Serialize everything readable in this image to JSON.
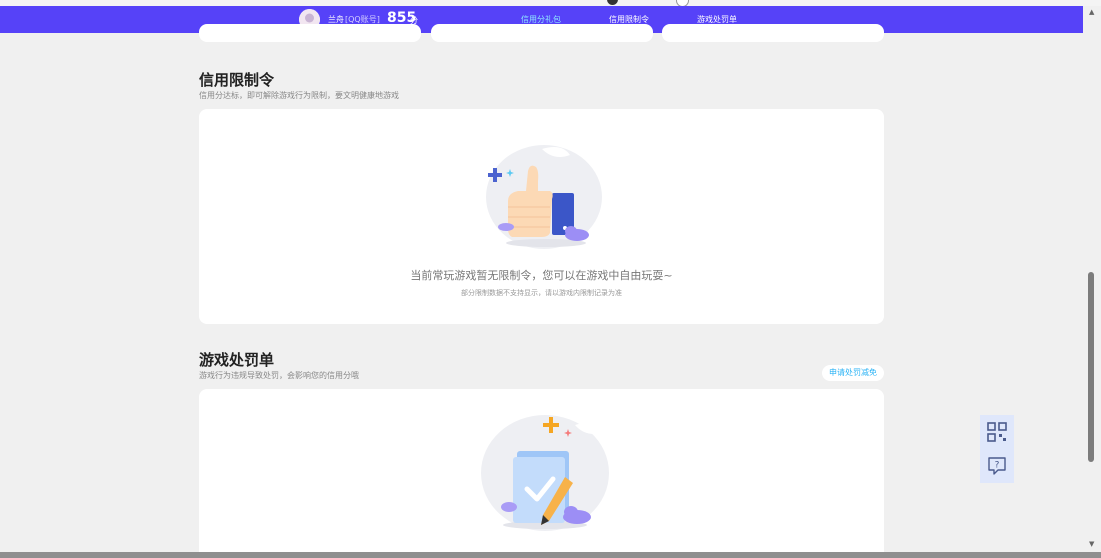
{
  "header": {
    "user_name": "兰舟",
    "account_label": "[QQ账号]",
    "score": "855",
    "score_unit": "分",
    "tabs": [
      {
        "label": "信用分礼包",
        "active": true
      },
      {
        "label": "信用限制令",
        "active": false
      },
      {
        "label": "游戏处罚单",
        "active": false
      }
    ]
  },
  "restriction_section": {
    "title": "信用限制令",
    "subtitle": "信用分达标，即可解除游戏行为限制，要文明健康地游戏",
    "empty_message": "当前常玩游戏暂无限制令，您可以在游戏中自由玩耍~",
    "empty_note": "部分限制数据不支持显示，请以游戏内限制记录为准"
  },
  "penalty_section": {
    "title": "游戏处罚单",
    "subtitle": "游戏行为违规导致处罚，会影响您的信用分哦",
    "appeal_button": "申请处罚减免"
  },
  "side_actions": {
    "qr_icon": "qr-code-icon",
    "feedback_icon": "help-feedback-icon"
  },
  "colors": {
    "topbar": "#5642f8",
    "active_tab": "#36dbff",
    "accent_blue": "#2bb3f5"
  }
}
